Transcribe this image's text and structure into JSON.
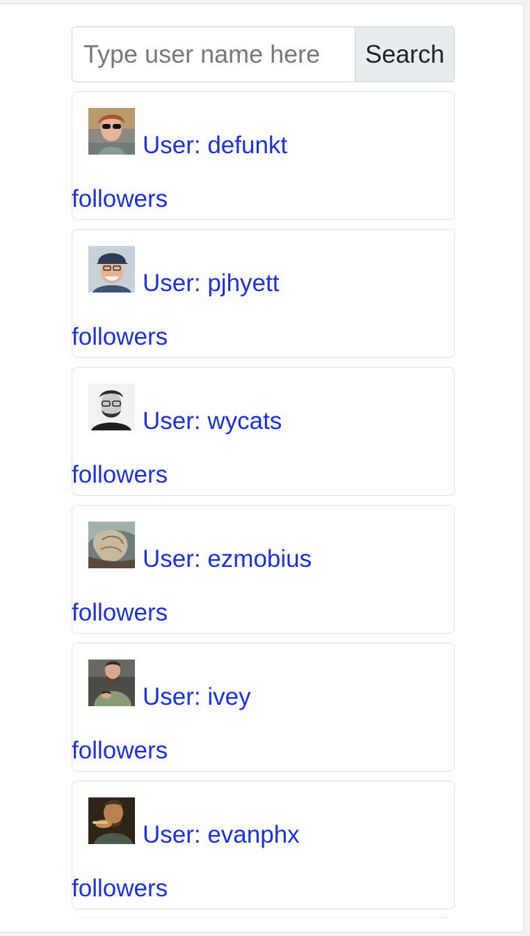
{
  "search": {
    "placeholder": "Type user name here",
    "value": "",
    "button_label": "Search"
  },
  "users": [
    {
      "label": "User: defunkt",
      "followers_label": "followers"
    },
    {
      "label": "User: pjhyett",
      "followers_label": "followers"
    },
    {
      "label": "User: wycats",
      "followers_label": "followers"
    },
    {
      "label": "User: ezmobius",
      "followers_label": "followers"
    },
    {
      "label": "User: ivey",
      "followers_label": "followers"
    },
    {
      "label": "User: evanphx",
      "followers_label": "followers"
    }
  ],
  "colors": {
    "link": "#1a31e0",
    "button_bg": "#e9ecef",
    "border": "#ced4da"
  }
}
